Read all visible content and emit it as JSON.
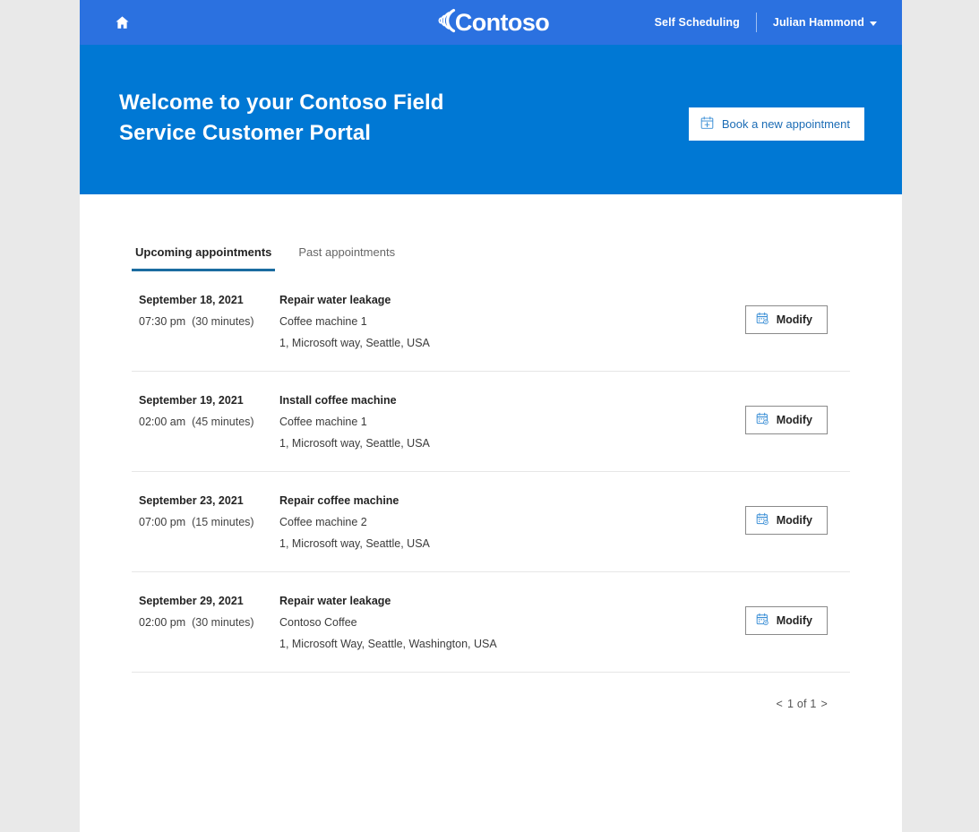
{
  "theme": {
    "navbar_blue": "#2b71e0",
    "hero_blue": "#0078d4",
    "accent_tab_underline": "#1b6ca0",
    "link_blue": "#1b6cb5",
    "page_background": "#e9e9e9",
    "divider": "#e6e6e6"
  },
  "navbar": {
    "home_icon": "home-icon",
    "brand": "Contoso",
    "self_scheduling_label": "Self Scheduling",
    "user_name": "Julian Hammond",
    "user_caret_icon": "chevron-down-icon"
  },
  "hero": {
    "title": "Welcome to your Contoso Field\nService Customer Portal",
    "book_button_label": "Book a new appointment",
    "book_button_icon": "calendar-plus-icon"
  },
  "tabs": [
    {
      "label": "Upcoming appointments",
      "active": true
    },
    {
      "label": "Past appointments",
      "active": false
    }
  ],
  "appointments": [
    {
      "date": "September 18, 2021",
      "time": "07:30 pm",
      "duration": "(30 minutes)",
      "title": "Repair water leakage",
      "asset": "Coffee machine 1",
      "address": "1, Microsoft way, Seattle, USA",
      "action_label": "Modify",
      "action_icon": "calendar-edit-icon"
    },
    {
      "date": "September 19, 2021",
      "time": "02:00 am",
      "duration": "(45 minutes)",
      "title": "Install coffee machine",
      "asset": "Coffee machine 1",
      "address": "1, Microsoft way, Seattle, USA",
      "action_label": "Modify",
      "action_icon": "calendar-edit-icon"
    },
    {
      "date": "September 23, 2021",
      "time": "07:00 pm",
      "duration": "(15 minutes)",
      "title": "Repair coffee machine",
      "asset": "Coffee machine 2",
      "address": "1, Microsoft way, Seattle, USA",
      "action_label": "Modify",
      "action_icon": "calendar-edit-icon"
    },
    {
      "date": "September 29, 2021",
      "time": "02:00 pm",
      "duration": "(30 minutes)",
      "title": "Repair water leakage",
      "asset": "Contoso Coffee",
      "address": "1, Microsoft Way, Seattle, Washington, USA",
      "action_label": "Modify",
      "action_icon": "calendar-edit-icon"
    }
  ],
  "pagination": {
    "prev_label": "<",
    "text": "1 of 1",
    "next_label": ">"
  }
}
